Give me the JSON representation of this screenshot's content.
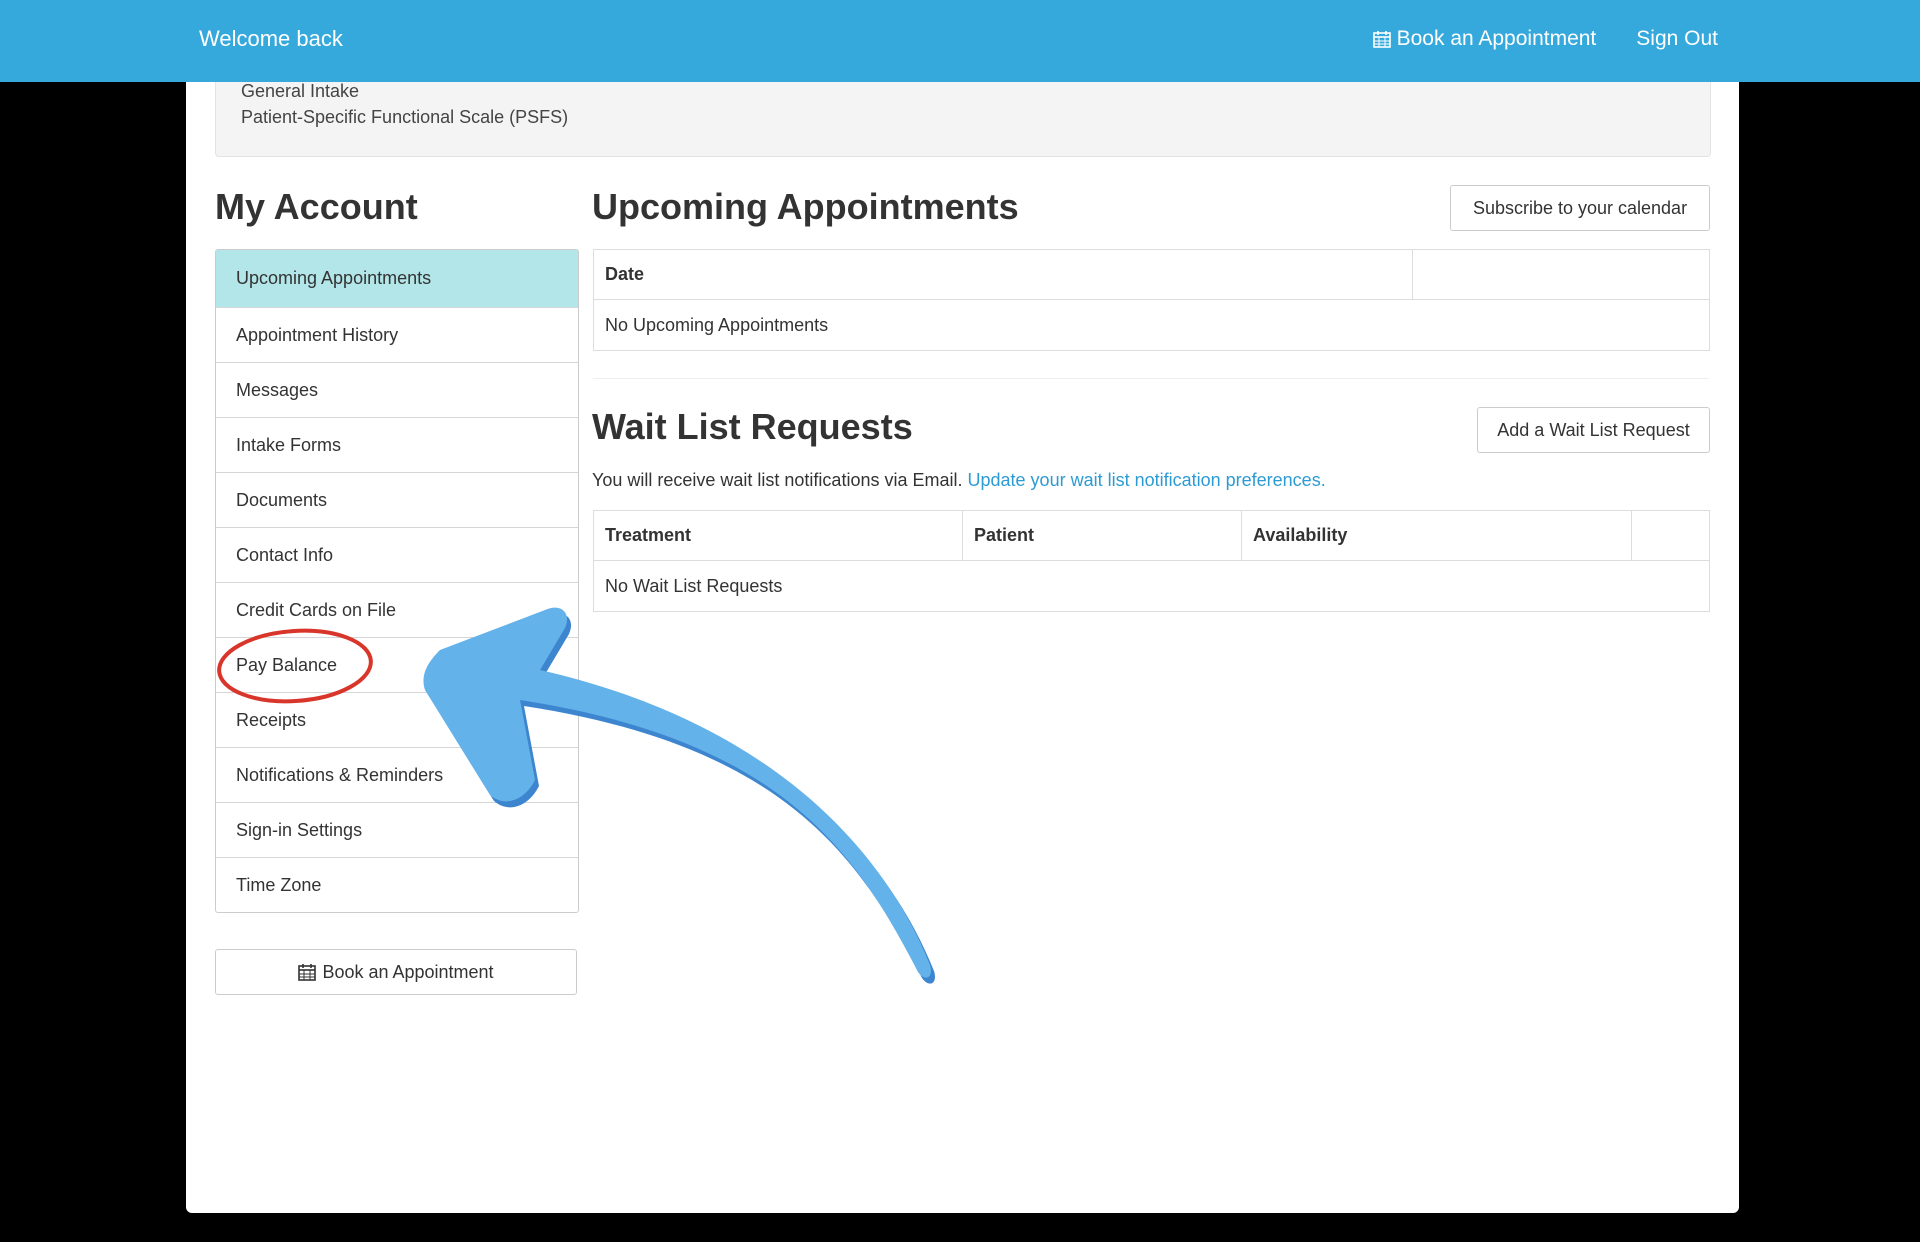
{
  "header": {
    "welcome": "Welcome back",
    "book_label": "Book an Appointment",
    "signout_label": "Sign Out"
  },
  "forms": {
    "items": [
      "General Intake",
      "Patient-Specific Functional Scale (PSFS)"
    ]
  },
  "sidebar": {
    "title": "My Account",
    "items": [
      {
        "label": "Upcoming Appointments",
        "active": true
      },
      {
        "label": "Appointment History"
      },
      {
        "label": "Messages"
      },
      {
        "label": "Intake Forms"
      },
      {
        "label": "Documents"
      },
      {
        "label": "Contact Info"
      },
      {
        "label": "Credit Cards on File"
      },
      {
        "label": "Pay Balance",
        "highlighted": true
      },
      {
        "label": "Receipts"
      },
      {
        "label": "Notifications & Reminders"
      },
      {
        "label": "Sign-in Settings"
      },
      {
        "label": "Time Zone"
      }
    ],
    "book_label": "Book an Appointment"
  },
  "upcoming": {
    "title": "Upcoming Appointments",
    "subscribe_label": "Subscribe to your calendar",
    "columns": [
      "Date",
      ""
    ],
    "empty": "No Upcoming Appointments"
  },
  "waitlist": {
    "title": "Wait List Requests",
    "add_label": "Add a Wait List Request",
    "note": "You will receive wait list notifications via Email.",
    "link": "Update your wait list notification preferences.",
    "columns": [
      "Treatment",
      "Patient",
      "Availability",
      ""
    ],
    "empty": "No Wait List Requests"
  },
  "colors": {
    "header": "#35a8dc",
    "active_item": "#b3e6e8",
    "link": "#2d9bd3",
    "annotation_circle": "#d9362b",
    "annotation_arrow": "#5aaee8"
  },
  "icons": {
    "calendar": "calendar-icon"
  }
}
